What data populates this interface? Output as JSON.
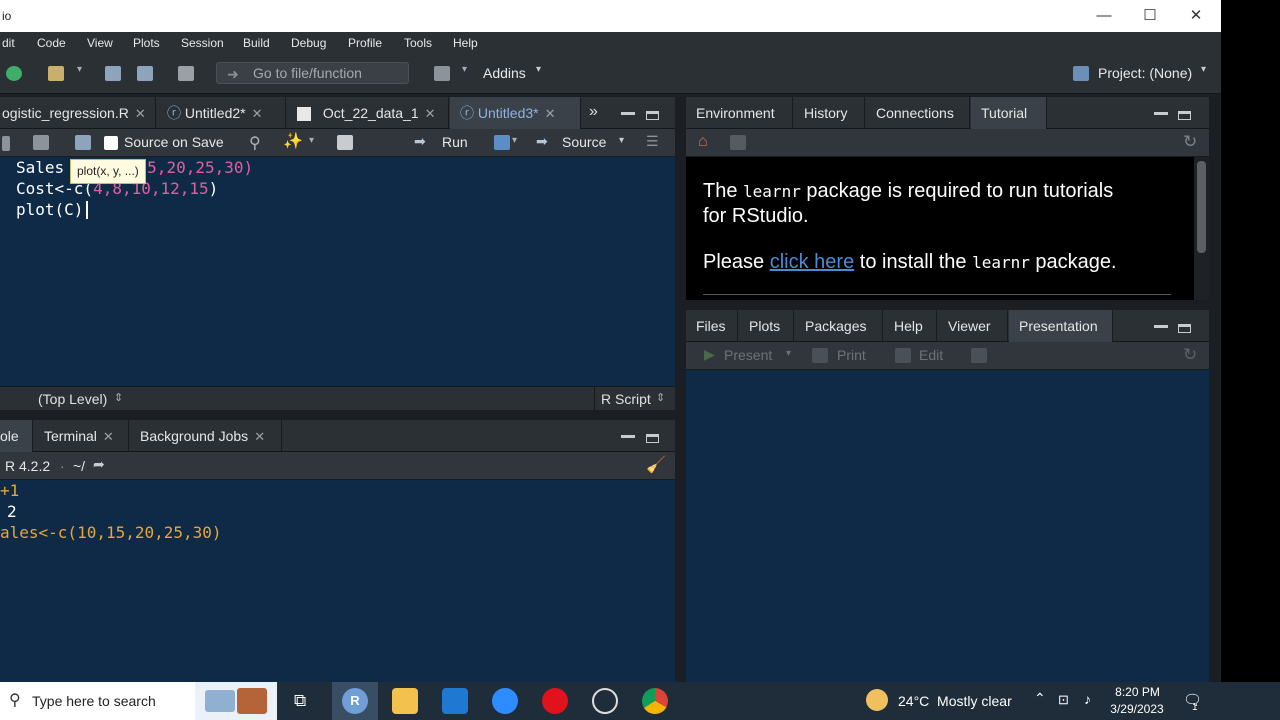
{
  "window": {
    "title": "io",
    "minimize": "—",
    "maximize": "☐",
    "close": "✕"
  },
  "menu": [
    "dit",
    "Code",
    "View",
    "Plots",
    "Session",
    "Build",
    "Debug",
    "Profile",
    "Tools",
    "Help"
  ],
  "toolbar": {
    "goto_placeholder": "Go to file/function",
    "addins": "Addins",
    "project": "Project: (None)"
  },
  "editor": {
    "tabs": [
      {
        "label": "ogistic_regression.R",
        "active": false
      },
      {
        "label": "Untitled2*",
        "active": false
      },
      {
        "label": "Oct_22_data_1",
        "active": false
      },
      {
        "label": "Untitled3*",
        "active": true
      }
    ],
    "source_on_save": "Source on Save",
    "run": "Run",
    "source": "Source",
    "tooltip": "plot(x, y, ...)",
    "lines": [
      {
        "a": "Sales",
        "b": "",
        "c": "5,20,25,30)"
      },
      {
        "a": "Cost<-c(",
        "b": "4,8,10,12,15",
        "c": ")"
      },
      {
        "a": "plot(C",
        "b": "",
        "c": ")"
      }
    ],
    "status_left": "(Top Level)",
    "status_right": "R Script"
  },
  "console": {
    "tabs": [
      "ole",
      "Terminal",
      "Background Jobs"
    ],
    "version": "R 4.2.2",
    "path": "~/",
    "lines": [
      "+1",
      "2",
      "ales<-c(10,15,20,25,30)"
    ]
  },
  "env": {
    "tabs": [
      "Environment",
      "History",
      "Connections",
      "Tutorial"
    ],
    "active": "Tutorial",
    "msg1_a": "The",
    "msg1_code": "learnr",
    "msg1_b": "package is required to run tutorials",
    "msg1_c": "for RStudio.",
    "msg2_a": "Please",
    "msg2_link": "click here",
    "msg2_b": "to install the",
    "msg2_code": "learnr",
    "msg2_c": "package."
  },
  "files": {
    "tabs": [
      "Files",
      "Plots",
      "Packages",
      "Help",
      "Viewer",
      "Presentation"
    ],
    "active": "Presentation",
    "present": "Present",
    "print": "Print",
    "edit": "Edit"
  },
  "taskbar": {
    "search_placeholder": "Type here to search",
    "weather": "24°C  Mostly clear",
    "time": "8:20 PM",
    "date": "3/29/2023",
    "notif": "1"
  },
  "colors": {
    "editor_bg": "#0f2a47",
    "chrome": "#2b3035",
    "accent_blue": "#4b8ad6",
    "number": "#e0609e",
    "console_text": "#e9a53a"
  }
}
